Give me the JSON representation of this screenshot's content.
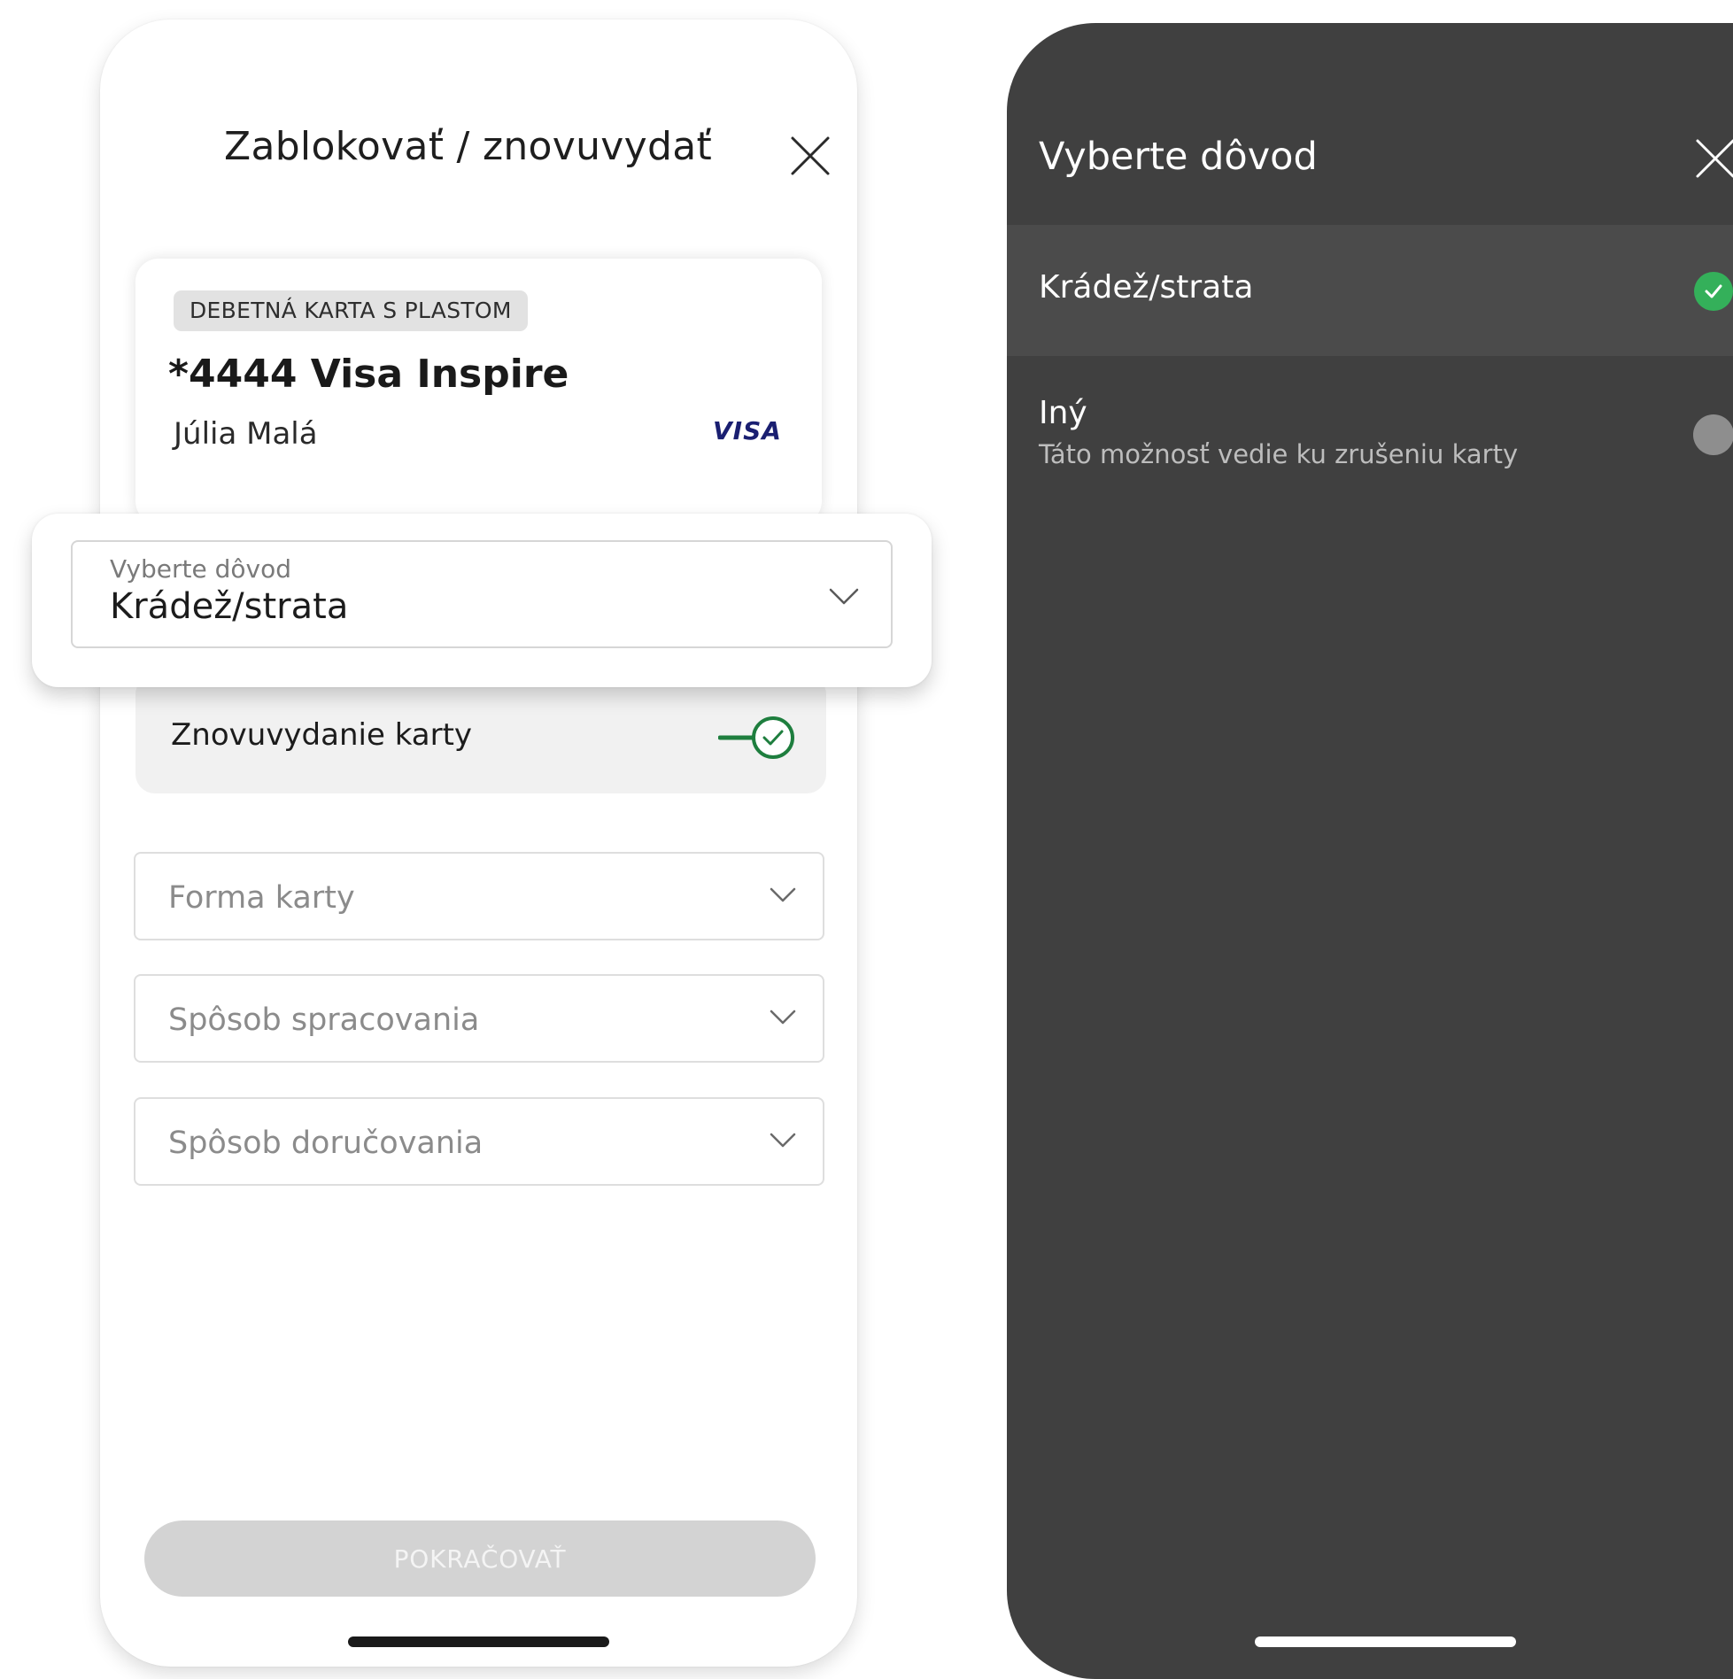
{
  "left_screen": {
    "title": "Zablokovať / znovuvydať",
    "close_icon": "close-icon",
    "card": {
      "badge": "DEBETNÁ KARTA S PLASTOM",
      "name": "*4444 Visa Inspire",
      "holder": "Júlia Malá",
      "brand": "VISA"
    },
    "reason_select": {
      "caption": "Vyberte dôvod",
      "value": "Krádež/strata"
    },
    "reissue_toggle": {
      "label": "Znovuvydanie karty",
      "on": true,
      "color": "#1e7e3e"
    },
    "selects": [
      {
        "placeholder": "Forma karty"
      },
      {
        "placeholder": "Spôsob spracovania"
      },
      {
        "placeholder": "Spôsob doručovania"
      }
    ],
    "continue_button": {
      "label": "POKRAČOVAŤ",
      "disabled": true
    }
  },
  "right_screen": {
    "title": "Vyberte dôvod",
    "close_icon": "close-icon",
    "options": [
      {
        "label": "Krádež/strata",
        "selected": true,
        "check_color": "#34b05a"
      },
      {
        "label": "Iný",
        "subtitle": "Táto možnosť vedie ku zrušeniu karty",
        "selected": false
      }
    ],
    "background": "#404040"
  }
}
